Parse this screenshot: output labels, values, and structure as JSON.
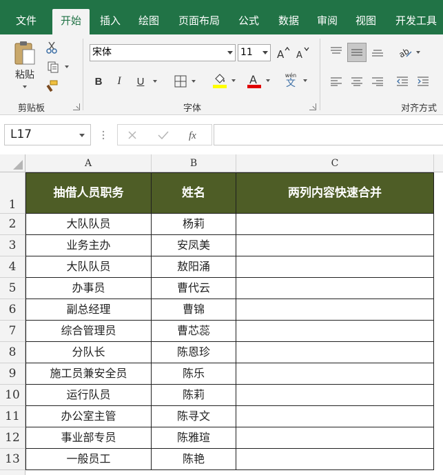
{
  "ribbon": {
    "tabs": [
      "文件",
      "开始",
      "插入",
      "绘图",
      "页面布局",
      "公式",
      "数据",
      "审阅",
      "视图",
      "开发工具"
    ],
    "active_tab": "开始",
    "clipboard": {
      "paste_label": "粘贴",
      "group_label": "剪贴板"
    },
    "font": {
      "font_name": "宋体",
      "font_size": "11",
      "group_label": "字体",
      "bold": "B",
      "italic": "I",
      "underline": "U",
      "phonetic_top": "wén",
      "phonetic_bottom": "文"
    },
    "alignment": {
      "group_label": "对齐方式"
    }
  },
  "formula_bar": {
    "name_box": "L17",
    "formula": ""
  },
  "sheet": {
    "columns": [
      "A",
      "B",
      "C"
    ],
    "row_numbers": [
      "1",
      "2",
      "3",
      "4",
      "5",
      "6",
      "7",
      "8",
      "9",
      "10",
      "11",
      "12",
      "13"
    ],
    "header": [
      "抽借人员职务",
      "姓名",
      "两列内容快速合并"
    ],
    "rows": [
      [
        "大队队员",
        "杨莉",
        ""
      ],
      [
        "业务主办",
        "安凤美",
        ""
      ],
      [
        "大队队员",
        "敖阳涌",
        ""
      ],
      [
        "办事员",
        "曹代云",
        ""
      ],
      [
        "副总经理",
        "曹锦",
        ""
      ],
      [
        "综合管理员",
        "曹芯蕊",
        ""
      ],
      [
        "分队长",
        "陈恩珍",
        ""
      ],
      [
        "施工员兼安全员",
        "陈乐",
        ""
      ],
      [
        "运行队员",
        "陈莉",
        ""
      ],
      [
        "办公室主管",
        "陈寻文",
        ""
      ],
      [
        "事业部专员",
        "陈雅瑄",
        ""
      ],
      [
        "一般员工",
        "陈艳",
        ""
      ]
    ]
  },
  "colors": {
    "ribbon_green": "#217346",
    "header_fill": "#4e5d26",
    "fill_yellow": "#ffff00",
    "font_red": "#e00000"
  }
}
